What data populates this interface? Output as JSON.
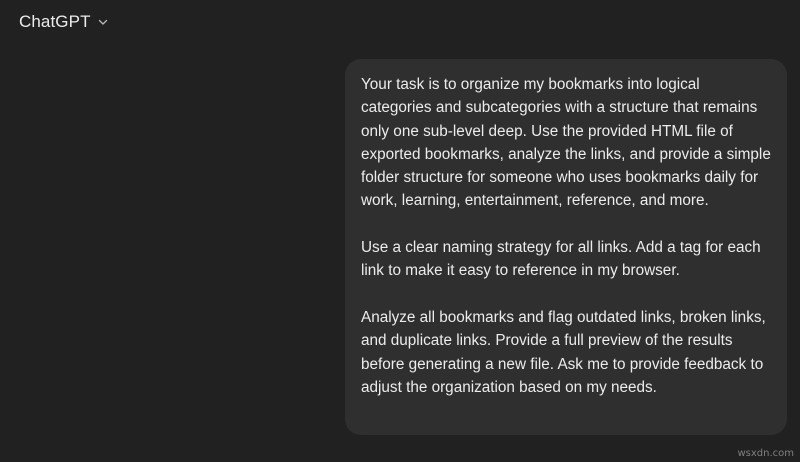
{
  "header": {
    "model_name": "ChatGPT",
    "dropdown_icon": "chevron-down-icon"
  },
  "conversation": {
    "user_message": {
      "paragraphs": [
        "Your task is to organize my bookmarks into logical categories and subcategories with a structure that remains only one sub-level deep. Use the provided HTML file of exported bookmarks, analyze the links, and provide a simple folder structure for someone who uses bookmarks daily for work, learning, entertainment, reference, and more.",
        "Use a clear naming strategy for all links. Add a tag for each link to make it easy to reference in my browser.",
        "Analyze all bookmarks and flag outdated links, broken links, and duplicate links. Provide a full preview of the results before generating a new file. Ask me to provide feedback to adjust the organization based on my needs."
      ]
    }
  },
  "watermark": "wsxdn.com",
  "colors": {
    "background": "#212121",
    "bubble": "#2f2f2f",
    "text": "#ececec"
  }
}
